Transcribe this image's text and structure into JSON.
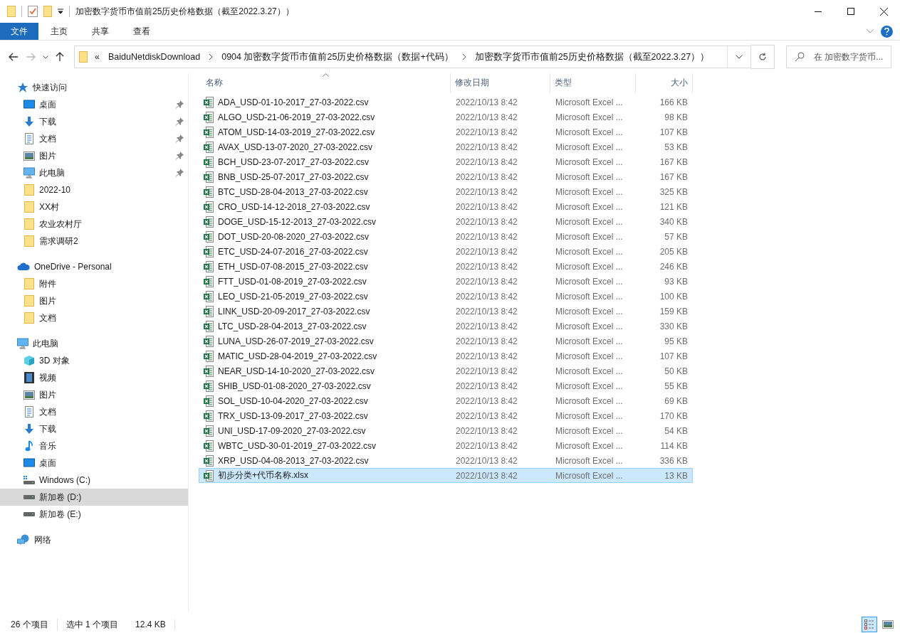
{
  "window": {
    "title": "加密数字货币市值前25历史价格数据（截至2022.3.27））"
  },
  "ribbon": {
    "tabs": [
      {
        "label": "文件",
        "selected": true
      },
      {
        "label": "主页",
        "selected": false
      },
      {
        "label": "共享",
        "selected": false
      },
      {
        "label": "查看",
        "selected": false
      }
    ]
  },
  "address": {
    "overflow": "«",
    "segments": [
      "BaiduNetdiskDownload",
      "0904 加密数字货币市值前25历史价格数据（数据+代码）",
      "加密数字货币市值前25历史价格数据（截至2022.3.27））"
    ]
  },
  "search": {
    "placeholder": "在 加密数字货币..."
  },
  "sidebar": {
    "sections": [
      {
        "label": "快速访问",
        "kind": "star",
        "children": [
          {
            "label": "桌面",
            "kind": "desktop",
            "pinned": true,
            "selected": false
          },
          {
            "label": "下载",
            "kind": "download",
            "pinned": true,
            "selected": false
          },
          {
            "label": "文档",
            "kind": "document",
            "pinned": true,
            "selected": false
          },
          {
            "label": "图片",
            "kind": "picture",
            "pinned": true,
            "selected": false
          },
          {
            "label": "此电脑",
            "kind": "pc",
            "pinned": true,
            "selected": false
          },
          {
            "label": "2022-10",
            "kind": "folder",
            "pinned": false,
            "selected": false
          },
          {
            "label": "XX村",
            "kind": "folder",
            "pinned": false,
            "selected": false
          },
          {
            "label": "农业农村厅",
            "kind": "folder",
            "pinned": false,
            "selected": false
          },
          {
            "label": "需求调研2",
            "kind": "folder",
            "pinned": false,
            "selected": false
          }
        ]
      },
      {
        "label": "OneDrive - Personal",
        "kind": "cloud",
        "children": [
          {
            "label": "附件",
            "kind": "folder",
            "pinned": false,
            "selected": false
          },
          {
            "label": "图片",
            "kind": "folder",
            "pinned": false,
            "selected": false
          },
          {
            "label": "文档",
            "kind": "folder",
            "pinned": false,
            "selected": false
          }
        ]
      },
      {
        "label": "此电脑",
        "kind": "pc",
        "children": [
          {
            "label": "3D 对象",
            "kind": "cube",
            "pinned": false,
            "selected": false
          },
          {
            "label": "视频",
            "kind": "video",
            "pinned": false,
            "selected": false
          },
          {
            "label": "图片",
            "kind": "picture",
            "pinned": false,
            "selected": false
          },
          {
            "label": "文档",
            "kind": "document",
            "pinned": false,
            "selected": false
          },
          {
            "label": "下载",
            "kind": "download",
            "pinned": false,
            "selected": false
          },
          {
            "label": "音乐",
            "kind": "music",
            "pinned": false,
            "selected": false
          },
          {
            "label": "桌面",
            "kind": "desktop",
            "pinned": false,
            "selected": false
          },
          {
            "label": "Windows (C:)",
            "kind": "windows-drive",
            "pinned": false,
            "selected": false
          },
          {
            "label": "新加卷 (D:)",
            "kind": "drive",
            "pinned": false,
            "selected": true
          },
          {
            "label": "新加卷 (E:)",
            "kind": "drive",
            "pinned": false,
            "selected": false
          }
        ]
      },
      {
        "label": "网络",
        "kind": "network"
      }
    ]
  },
  "table": {
    "columns": [
      "名称",
      "修改日期",
      "类型",
      "大小"
    ],
    "rows": [
      {
        "name": "ADA_USD-01-10-2017_27-03-2022.csv",
        "date": "2022/10/13 8:42",
        "type": "Microsoft Excel ...",
        "size": "166 KB",
        "selected": false
      },
      {
        "name": "ALGO_USD-21-06-2019_27-03-2022.csv",
        "date": "2022/10/13 8:42",
        "type": "Microsoft Excel ...",
        "size": "98 KB",
        "selected": false
      },
      {
        "name": "ATOM_USD-14-03-2019_27-03-2022.csv",
        "date": "2022/10/13 8:42",
        "type": "Microsoft Excel ...",
        "size": "107 KB",
        "selected": false
      },
      {
        "name": "AVAX_USD-13-07-2020_27-03-2022.csv",
        "date": "2022/10/13 8:42",
        "type": "Microsoft Excel ...",
        "size": "53 KB",
        "selected": false
      },
      {
        "name": "BCH_USD-23-07-2017_27-03-2022.csv",
        "date": "2022/10/13 8:42",
        "type": "Microsoft Excel ...",
        "size": "167 KB",
        "selected": false
      },
      {
        "name": "BNB_USD-25-07-2017_27-03-2022.csv",
        "date": "2022/10/13 8:42",
        "type": "Microsoft Excel ...",
        "size": "167 KB",
        "selected": false
      },
      {
        "name": "BTC_USD-28-04-2013_27-03-2022.csv",
        "date": "2022/10/13 8:42",
        "type": "Microsoft Excel ...",
        "size": "325 KB",
        "selected": false
      },
      {
        "name": "CRO_USD-14-12-2018_27-03-2022.csv",
        "date": "2022/10/13 8:42",
        "type": "Microsoft Excel ...",
        "size": "121 KB",
        "selected": false
      },
      {
        "name": "DOGE_USD-15-12-2013_27-03-2022.csv",
        "date": "2022/10/13 8:42",
        "type": "Microsoft Excel ...",
        "size": "340 KB",
        "selected": false
      },
      {
        "name": "DOT_USD-20-08-2020_27-03-2022.csv",
        "date": "2022/10/13 8:42",
        "type": "Microsoft Excel ...",
        "size": "57 KB",
        "selected": false
      },
      {
        "name": "ETC_USD-24-07-2016_27-03-2022.csv",
        "date": "2022/10/13 8:42",
        "type": "Microsoft Excel ...",
        "size": "205 KB",
        "selected": false
      },
      {
        "name": "ETH_USD-07-08-2015_27-03-2022.csv",
        "date": "2022/10/13 8:42",
        "type": "Microsoft Excel ...",
        "size": "246 KB",
        "selected": false
      },
      {
        "name": "FTT_USD-01-08-2019_27-03-2022.csv",
        "date": "2022/10/13 8:42",
        "type": "Microsoft Excel ...",
        "size": "93 KB",
        "selected": false
      },
      {
        "name": "LEO_USD-21-05-2019_27-03-2022.csv",
        "date": "2022/10/13 8:42",
        "type": "Microsoft Excel ...",
        "size": "100 KB",
        "selected": false
      },
      {
        "name": "LINK_USD-20-09-2017_27-03-2022.csv",
        "date": "2022/10/13 8:42",
        "type": "Microsoft Excel ...",
        "size": "159 KB",
        "selected": false
      },
      {
        "name": "LTC_USD-28-04-2013_27-03-2022.csv",
        "date": "2022/10/13 8:42",
        "type": "Microsoft Excel ...",
        "size": "330 KB",
        "selected": false
      },
      {
        "name": "LUNA_USD-26-07-2019_27-03-2022.csv",
        "date": "2022/10/13 8:42",
        "type": "Microsoft Excel ...",
        "size": "95 KB",
        "selected": false
      },
      {
        "name": "MATIC_USD-28-04-2019_27-03-2022.csv",
        "date": "2022/10/13 8:42",
        "type": "Microsoft Excel ...",
        "size": "107 KB",
        "selected": false
      },
      {
        "name": "NEAR_USD-14-10-2020_27-03-2022.csv",
        "date": "2022/10/13 8:42",
        "type": "Microsoft Excel ...",
        "size": "50 KB",
        "selected": false
      },
      {
        "name": "SHIB_USD-01-08-2020_27-03-2022.csv",
        "date": "2022/10/13 8:42",
        "type": "Microsoft Excel ...",
        "size": "55 KB",
        "selected": false
      },
      {
        "name": "SOL_USD-10-04-2020_27-03-2022.csv",
        "date": "2022/10/13 8:42",
        "type": "Microsoft Excel ...",
        "size": "69 KB",
        "selected": false
      },
      {
        "name": "TRX_USD-13-09-2017_27-03-2022.csv",
        "date": "2022/10/13 8:42",
        "type": "Microsoft Excel ...",
        "size": "170 KB",
        "selected": false
      },
      {
        "name": "UNI_USD-17-09-2020_27-03-2022.csv",
        "date": "2022/10/13 8:42",
        "type": "Microsoft Excel ...",
        "size": "54 KB",
        "selected": false
      },
      {
        "name": "WBTC_USD-30-01-2019_27-03-2022.csv",
        "date": "2022/10/13 8:42",
        "type": "Microsoft Excel ...",
        "size": "114 KB",
        "selected": false
      },
      {
        "name": "XRP_USD-04-08-2013_27-03-2022.csv",
        "date": "2022/10/13 8:42",
        "type": "Microsoft Excel ...",
        "size": "336 KB",
        "selected": false
      },
      {
        "name": "初步分类+代币名称.xlsx",
        "date": "2022/10/13 8:42",
        "type": "Microsoft Excel ...",
        "size": "13 KB",
        "selected": true
      }
    ]
  },
  "status_bar": {
    "count": "26 个项目",
    "selection": "选中 1 个项目",
    "selection_size": "12.4 KB",
    "views": [
      {
        "kind": "details",
        "selected": true
      },
      {
        "kind": "large-icons",
        "selected": false
      }
    ]
  }
}
